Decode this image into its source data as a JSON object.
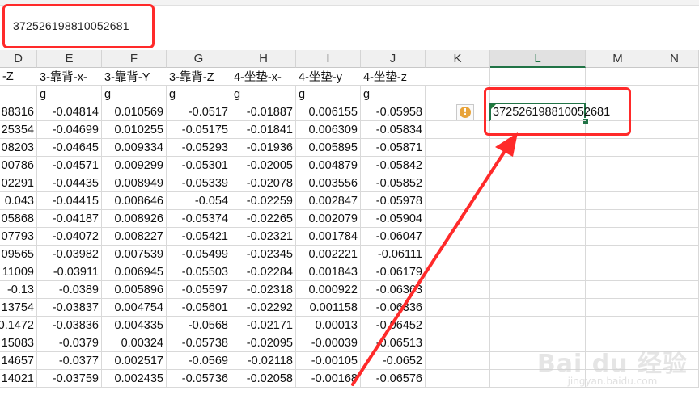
{
  "formula_bar": {
    "value": "37252619881005268​1"
  },
  "columns": [
    "D",
    "E",
    "F",
    "G",
    "H",
    "I",
    "J",
    "K",
    "L",
    "M",
    "N"
  ],
  "header_row1": [
    "-Z",
    "3-靠背-x-",
    "3-靠背-Y",
    "3-靠背-Z",
    "4-坐垫-x-",
    "4-坐垫-y",
    "4-坐垫-z"
  ],
  "header_row2": [
    "",
    "g",
    "g",
    "g",
    "g",
    "g",
    "g"
  ],
  "rows": [
    [
      "88316",
      "-0.04814",
      "0.010569",
      "-0.0517",
      "-0.01887",
      "0.006155",
      "-0.05958"
    ],
    [
      "25354",
      "-0.04699",
      "0.010255",
      "-0.05175",
      "-0.01841",
      "0.006309",
      "-0.05834"
    ],
    [
      "08203",
      "-0.04645",
      "0.009334",
      "-0.05293",
      "-0.01936",
      "0.005895",
      "-0.05871"
    ],
    [
      "00786",
      "-0.04571",
      "0.009299",
      "-0.05301",
      "-0.02005",
      "0.004879",
      "-0.05842"
    ],
    [
      "02291",
      "-0.04435",
      "0.008949",
      "-0.05339",
      "-0.02078",
      "0.003556",
      "-0.05852"
    ],
    [
      "0.043",
      "-0.04415",
      "0.008646",
      "-0.054",
      "-0.02259",
      "0.002847",
      "-0.05978"
    ],
    [
      "05868",
      "-0.04187",
      "0.008926",
      "-0.05374",
      "-0.02265",
      "0.002079",
      "-0.05904"
    ],
    [
      "07793",
      "-0.04072",
      "0.008227",
      "-0.05421",
      "-0.02321",
      "0.001784",
      "-0.06047"
    ],
    [
      "09565",
      "-0.03982",
      "0.007539",
      "-0.05499",
      "-0.02345",
      "0.002221",
      "-0.06111"
    ],
    [
      "11009",
      "-0.03911",
      "0.006945",
      "-0.05503",
      "-0.02284",
      "0.001843",
      "-0.06179"
    ],
    [
      "-0.13",
      "-0.0389",
      "0.005896",
      "-0.05597",
      "-0.02318",
      "0.000922",
      "-0.06363"
    ],
    [
      "13754",
      "-0.03837",
      "0.004754",
      "-0.05601",
      "-0.02292",
      "0.001158",
      "-0.06336"
    ],
    [
      "0.1472",
      "-0.03836",
      "0.004335",
      "-0.0568",
      "-0.02171",
      "0.00013",
      "-0.06452"
    ],
    [
      "15083",
      "-0.0379",
      "0.00324",
      "-0.05738",
      "-0.02095",
      "-0.00039",
      "-0.06513"
    ],
    [
      "14657",
      "-0.0377",
      "0.002517",
      "-0.0569",
      "-0.02118",
      "-0.00105",
      "-0.0652"
    ],
    [
      "14021",
      "-0.03759",
      "0.002435",
      "-0.05736",
      "-0.02058",
      "-0.00168",
      "-0.06576"
    ]
  ],
  "active_cell": {
    "column": "L",
    "value": "372526198810052681"
  },
  "icons": {
    "warning": "warning-icon",
    "error_indicator": "green-triangle-icon"
  },
  "colors": {
    "annotation": "#ff2a2a",
    "selection": "#217346",
    "warning": "#e8a33a"
  },
  "watermark": {
    "main": "Bai du 经验",
    "sub": "jingyan.baidu.com"
  }
}
